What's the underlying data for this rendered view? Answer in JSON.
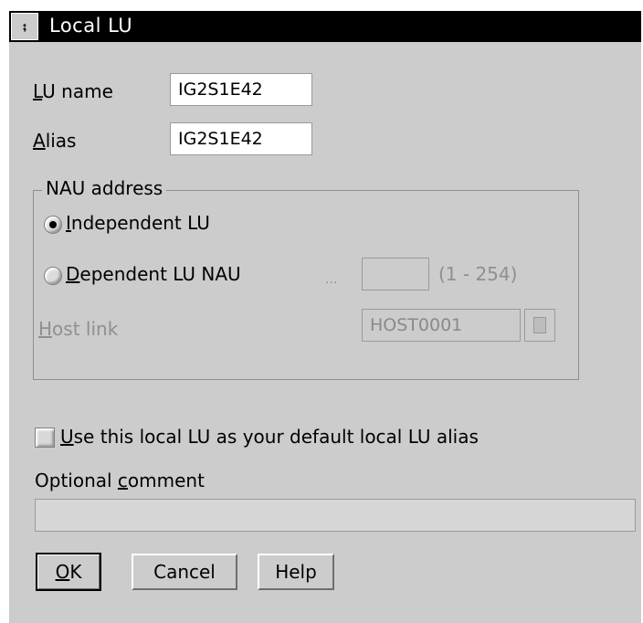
{
  "window": {
    "title": "Local LU",
    "system_menu_icon": "down-caret-icon"
  },
  "fields": {
    "lu_name": {
      "label_accel": "L",
      "label_rest": "U name",
      "value": "IG2S1E42"
    },
    "alias": {
      "label_accel": "A",
      "label_rest": "lias",
      "value": "IG2S1E42"
    }
  },
  "nau_address": {
    "legend": "NAU address",
    "independent": {
      "label_accel": "I",
      "label_rest": "ndependent LU",
      "checked": true
    },
    "dependent": {
      "label_accel": "D",
      "label_rest": "ependent LU NAU",
      "checked": false,
      "ellipsis": "...",
      "value": "",
      "range": "(1 - 254)"
    },
    "host_link": {
      "label_accel": "H",
      "label_rest": "ost link",
      "value": "HOST0001",
      "enabled": false
    }
  },
  "default_alias": {
    "label_accel": "U",
    "label_rest": "se this local LU as your default local LU alias",
    "checked": false
  },
  "comment": {
    "label_before": "Optional ",
    "label_accel": "c",
    "label_rest": "omment",
    "value": ""
  },
  "buttons": {
    "ok": {
      "accel": "O",
      "rest": "K"
    },
    "cancel": "Cancel",
    "help": "Help"
  },
  "colors": {
    "dialog_background": "#cccccc",
    "titlebar": "#000000",
    "disabled_text": "#8f8f8f"
  }
}
